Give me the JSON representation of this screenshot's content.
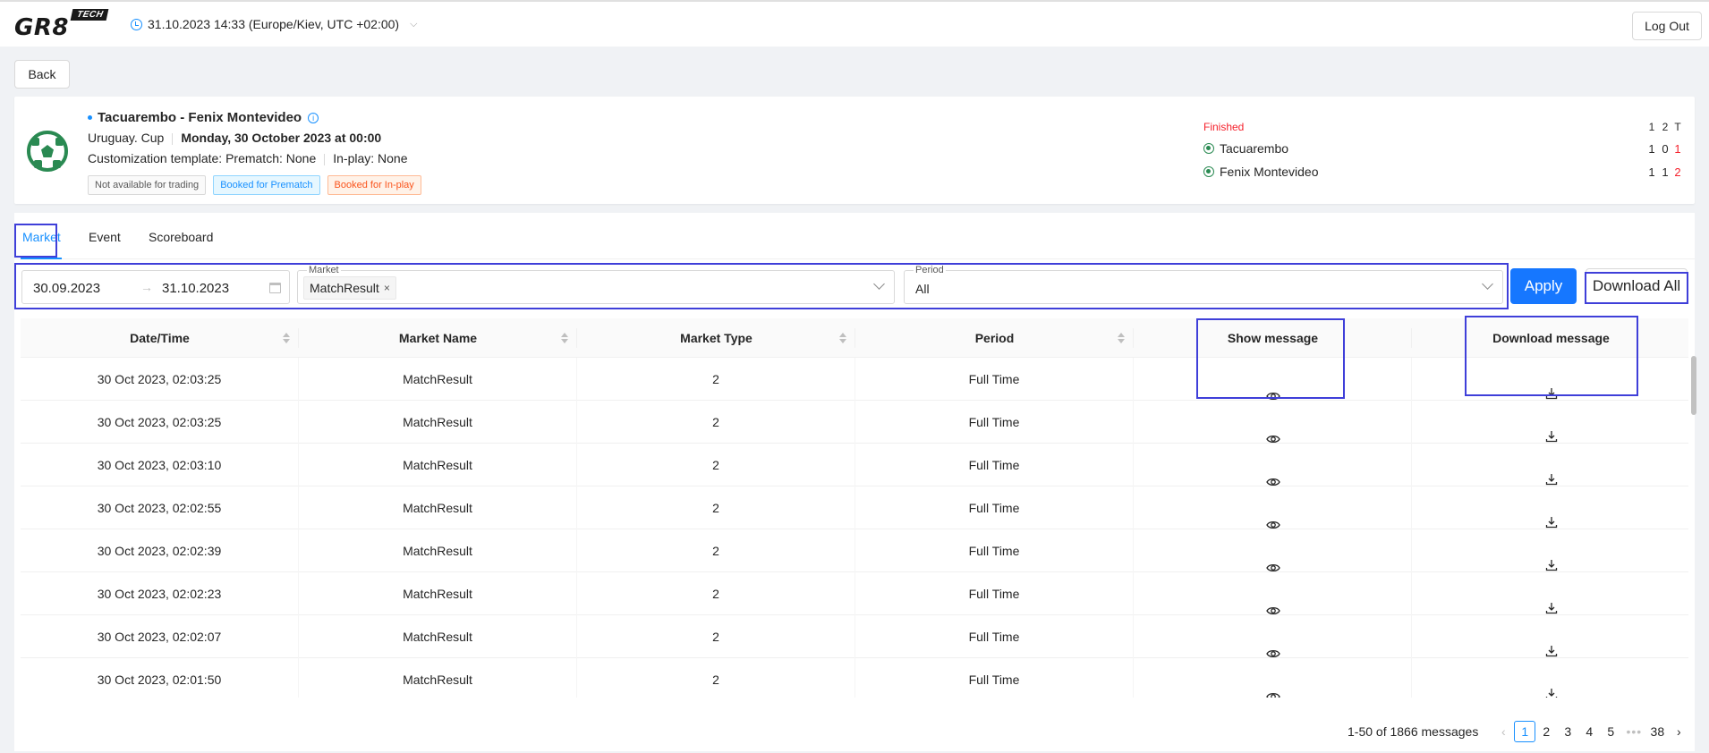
{
  "app": {
    "logo_main": "GR8",
    "logo_tech": "TECH",
    "timezone": "31.10.2023 14:33 (Europe/Kiev, UTC +02:00)"
  },
  "header": {
    "logout_label": "Log Out",
    "back_label": "Back"
  },
  "event": {
    "title": "Tacuarembo - Fenix Montevideo",
    "tournament": "Uruguay. Cup",
    "date": "Monday, 30 October 2023 at 00:00",
    "customization": "Customization template: Prematch: None",
    "inplay": "In-play: None",
    "tags": [
      "Not available for trading",
      "Booked for Prematch",
      "Booked for In-play"
    ],
    "status": "Finished",
    "score_headers": [
      "1",
      "2",
      "T"
    ],
    "teams": [
      {
        "name": "Tacuarembo",
        "scores": [
          "1",
          "0",
          "1"
        ]
      },
      {
        "name": "Fenix Montevideo",
        "scores": [
          "1",
          "1",
          "2"
        ]
      }
    ]
  },
  "tabs": [
    "Market",
    "Event",
    "Scoreboard"
  ],
  "filters": {
    "date_from": "30.09.2023",
    "date_to": "31.10.2023",
    "market_label": "Market",
    "market_chip": "MatchResult",
    "period_label": "Period",
    "period_value": "All",
    "apply_label": "Apply",
    "download_all_label": "Download All"
  },
  "table": {
    "columns": [
      "Date/Time",
      "Market Name",
      "Market Type",
      "Period",
      "Show message",
      "Download message"
    ],
    "rows": [
      {
        "datetime": "30 Oct 2023, 02:03:25",
        "market_name": "MatchResult",
        "market_type": "2",
        "period": "Full Time"
      },
      {
        "datetime": "30 Oct 2023, 02:03:25",
        "market_name": "MatchResult",
        "market_type": "2",
        "period": "Full Time"
      },
      {
        "datetime": "30 Oct 2023, 02:03:10",
        "market_name": "MatchResult",
        "market_type": "2",
        "period": "Full Time"
      },
      {
        "datetime": "30 Oct 2023, 02:02:55",
        "market_name": "MatchResult",
        "market_type": "2",
        "period": "Full Time"
      },
      {
        "datetime": "30 Oct 2023, 02:02:39",
        "market_name": "MatchResult",
        "market_type": "2",
        "period": "Full Time"
      },
      {
        "datetime": "30 Oct 2023, 02:02:23",
        "market_name": "MatchResult",
        "market_type": "2",
        "period": "Full Time"
      },
      {
        "datetime": "30 Oct 2023, 02:02:07",
        "market_name": "MatchResult",
        "market_type": "2",
        "period": "Full Time"
      },
      {
        "datetime": "30 Oct 2023, 02:01:50",
        "market_name": "MatchResult",
        "market_type": "2",
        "period": "Full Time"
      }
    ]
  },
  "pagination": {
    "total": "1-50 of 1866 messages",
    "pages": [
      "1",
      "2",
      "3",
      "4",
      "5"
    ],
    "ellipsis": "•••",
    "last": "38",
    "current": "1"
  },
  "colors": {
    "primary": "#1677ff",
    "highlight": "#3f3fd9",
    "danger": "#f5222d",
    "team_icon": "#2a8a52"
  }
}
